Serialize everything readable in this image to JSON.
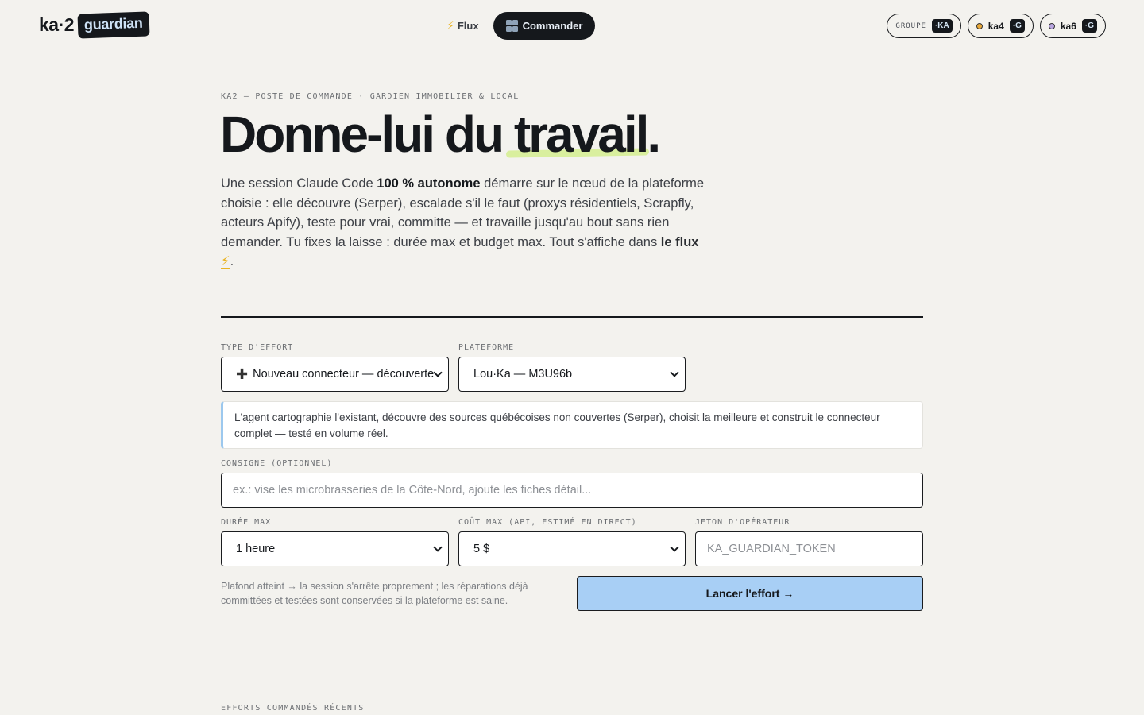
{
  "header": {
    "logo_text": "ka·2",
    "logo_badge": "guardian",
    "nav": [
      {
        "label": "Flux",
        "icon": "bolt-icon",
        "active": false
      },
      {
        "label": "Commander",
        "icon": "grid-icon",
        "active": true
      }
    ],
    "pills": {
      "group_label": "GROUPE",
      "group_tag": "·KA",
      "nodes": [
        {
          "label": "ka4",
          "tag": "·G",
          "dot_color": "#e9a93a"
        },
        {
          "label": "ka6",
          "tag": "·G",
          "dot_color": "#b9a6e0"
        }
      ]
    }
  },
  "main": {
    "eyebrow": "KA2 — POSTE DE COMMANDE · GARDIEN IMMOBILIER & LOCAL",
    "headline_start": "Donne-lui du ",
    "headline_highlight": "travail",
    "headline_end": ".",
    "intro": {
      "part1": "Une session Claude Code ",
      "bold": "100 % autonome",
      "part2": " démarre sur le nœud de la plateforme choisie : elle découvre (Serper), escalade s'il le faut (proxys résidentiels, Scrapfly, acteurs Apify), teste pour vrai, committe — et travaille jusqu'au bout sans rien demander. Tu fixes la laisse : durée max et budget max. Tout s'affiche dans ",
      "link": "le flux",
      "bolt": "⚡",
      "end": "."
    }
  },
  "form": {
    "effort_label": "TYPE D'EFFORT",
    "effort_value": "Nouveau connecteur — découverte",
    "effort_icon": "plus-icon",
    "platform_label": "PLATEFORME",
    "platform_value": "Lou·Ka — M3U96b",
    "description": "L'agent cartographie l'existant, découvre des sources québécoises non couvertes (Serper), choisit la meilleure et construit le connecteur complet — testé en volume réel.",
    "instruction_label": "CONSIGNE (OPTIONNEL)",
    "instruction_placeholder": "ex.: vise les microbrasseries de la Côte-Nord, ajoute les fiches détail...",
    "duration_label": "DURÉE MAX",
    "duration_value": "1 heure",
    "cost_label": "COÛT MAX (API, ESTIMÉ EN DIRECT)",
    "cost_value": "5 $",
    "token_label": "JETON D'OPÉRATEUR",
    "token_placeholder": "KA_GUARDIAN_TOKEN",
    "footnote": "Plafond atteint → la session s'arrête proprement ; les réparations déjà committées et testées sont conservées si la plateforme est saine.",
    "launch_label": "Lancer l'effort →"
  },
  "recent": {
    "label": "EFFORTS COMMANDÉS RÉCENTS"
  },
  "colors": {
    "background": "#f3f2ee",
    "accent_blue": "#a8cff5",
    "highlight_green": "#d9ef9e",
    "ink": "#15181c"
  }
}
